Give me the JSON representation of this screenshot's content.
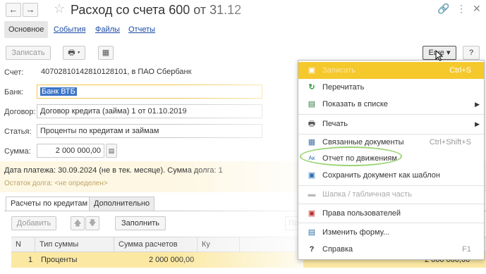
{
  "title": "Расход со счета 600 от 31.12",
  "sections": [
    "Основное",
    "События",
    "Файлы",
    "Отчеты"
  ],
  "commands": {
    "post": "Записать",
    "more": "Еще",
    "help": "?"
  },
  "labels": {
    "account": "Счет:",
    "bank": "Банк:",
    "contract": "Договор:",
    "article": "Статья:",
    "sum": "Сумма:"
  },
  "fields": {
    "account": "40702810142810128101, в ПАО Сбербанк",
    "bank": "Банк ВТБ",
    "contract": "Договор кредита (займа) 1 от 01.10.2019",
    "article": "Проценты по кредитам и займам",
    "sum": "2 000 000,00"
  },
  "info": {
    "line1": "Дата платежа: 30.09.2024 (не в тек. месяце). Сумма долга: 1",
    "line2": "Остаток долга: <не определен>"
  },
  "inner_tabs": [
    "Расчеты по кредитам",
    "Дополнительно"
  ],
  "table_toolbar": {
    "add": "Добавить",
    "fill": "Заполнить",
    "search_hint": "По"
  },
  "table": {
    "columns": [
      "N",
      "Тип суммы",
      "Сумма расчетов",
      "Ку"
    ],
    "rows": [
      {
        "n": "1",
        "type": "Проценты",
        "amount": "2 000 000,00",
        "right_amount": "2 000 000,00"
      }
    ]
  },
  "menu": [
    {
      "icon": "save-icon",
      "label": "Записать",
      "shortcut": "Ctrl+S",
      "state": "highlight-disabled"
    },
    {
      "icon": "refresh-icon",
      "label": "Перечитать",
      "shortcut": ""
    },
    {
      "icon": "list-icon",
      "label": "Показать в списке",
      "shortcut": "",
      "submenu": true
    },
    {
      "icon": "print-icon",
      "label": "Печать",
      "shortcut": "",
      "submenu": true
    },
    {
      "icon": "linked-docs-icon",
      "label": "Связанные документы",
      "shortcut": "Ctrl+Shift+S"
    },
    {
      "icon": "movements-report-icon",
      "label": "Отчет по движениям",
      "shortcut": ""
    },
    {
      "icon": "template-icon",
      "label": "Сохранить документ как шаблон",
      "shortcut": ""
    },
    {
      "icon": "header-table-icon",
      "label": "Шапка / табличная часть",
      "shortcut": "",
      "state": "disabled"
    },
    {
      "icon": "user-rights-icon",
      "label": "Права пользователей",
      "shortcut": ""
    },
    {
      "icon": "change-form-icon",
      "label": "Изменить форму...",
      "shortcut": ""
    },
    {
      "icon": "help-icon",
      "label": "Справка",
      "shortcut": "F1"
    }
  ],
  "colors": {
    "highlight": "#f5c82c",
    "selection": "#3d74c9",
    "link": "#1b4aa5",
    "annotation_circle": "#9bd474"
  }
}
